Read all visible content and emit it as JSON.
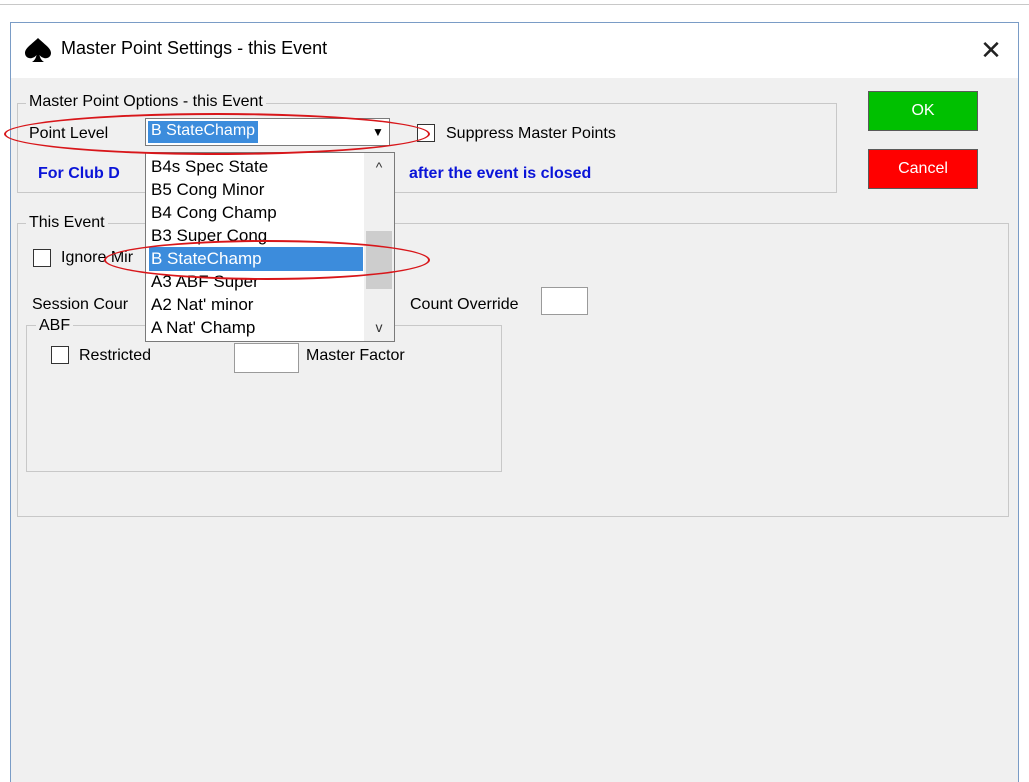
{
  "window": {
    "title": "Master Point Settings - this Event",
    "close_glyph": "✕"
  },
  "options_group": {
    "legend": "Master Point Options - this Event",
    "point_level_label": "Point Level",
    "point_level_value": "B StateChamp",
    "suppress_label": "Suppress  Master Points",
    "info_text_left": "For Club D",
    "info_text_right": "after the event is closed"
  },
  "buttons": {
    "ok": "OK",
    "cancel": "Cancel"
  },
  "event_group": {
    "legend": "This Event",
    "ignore_label": "Ignore Mir",
    "session_count_label": "Session Cour",
    "count_override_label": "Count Override",
    "count_override_value": ""
  },
  "abf_group": {
    "legend": "ABF",
    "restricted_label": "Restricted",
    "master_factor_label": "Master Factor",
    "master_factor_value": ""
  },
  "dropdown": {
    "items": [
      "B4s Spec State",
      "B5 Cong Minor",
      "B4 Cong Champ",
      "B3 Super Cong",
      "B StateChamp",
      "A3 ABF Super",
      "A2 Nat' minor",
      "A Nat' Champ"
    ],
    "selected_index": 4,
    "scroll_up_glyph": "^",
    "scroll_down_glyph": "v"
  },
  "icons": {
    "app_icon": "spade-icon",
    "combo_arrow": "▼"
  },
  "colors": {
    "ok_button": "#00c000",
    "cancel_button": "#ff0000",
    "selection": "#3c8cdc",
    "info_text": "#0a14d8",
    "annotation": "#d8161a"
  }
}
